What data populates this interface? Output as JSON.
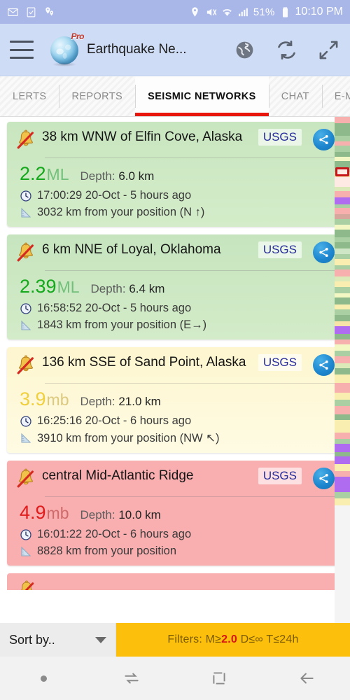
{
  "status_bar": {
    "left_icons": [
      "gmail-icon",
      "tasks-icon",
      "location-pins-icon"
    ],
    "right_icons": [
      "location-icon",
      "mute-icon",
      "wifi-icon",
      "signal-icon",
      "battery-icon"
    ],
    "battery_percent": "51%",
    "time": "10:10 PM"
  },
  "app_bar": {
    "menu_icon": "hamburger-menu-icon",
    "logo_badge": "Pro",
    "title": "Earthquake Ne...",
    "actions": [
      {
        "name": "map-globe-button",
        "icon": "globe-icon"
      },
      {
        "name": "refresh-button",
        "icon": "refresh-icon"
      },
      {
        "name": "fullscreen-button",
        "icon": "expand-icon"
      }
    ]
  },
  "tabs": [
    {
      "label": "LERTS",
      "active": false
    },
    {
      "label": "REPORTS",
      "active": false
    },
    {
      "label": "SEISMIC NETWORKS",
      "active": true
    },
    {
      "label": "CHAT",
      "active": false
    },
    {
      "label": "E-MAILS",
      "active": false
    }
  ],
  "quakes": [
    {
      "place": "38 km WNW of Elfin Cove, Alaska",
      "source": "USGS",
      "magnitude": "2.2",
      "mag_unit": "ML",
      "depth_label": "Depth:",
      "depth_value": "6.0 km",
      "time": "17:00:29 20-Oct - 5 hours ago",
      "distance": "3032 km from your position (N ↑)",
      "theme": "green",
      "alert_icon": "bell-muted-icon"
    },
    {
      "place": "6 km NNE of Loyal, Oklahoma",
      "source": "USGS",
      "magnitude": "2.39",
      "mag_unit": "ML",
      "depth_label": "Depth:",
      "depth_value": "6.4 km",
      "time": "16:58:52 20-Oct - 5 hours ago",
      "distance": "1843 km from your position (E→)",
      "theme": "green2",
      "alert_icon": "bell-muted-icon"
    },
    {
      "place": "136 km SSE of Sand Point, Alaska",
      "source": "USGS",
      "magnitude": "3.9",
      "mag_unit": "mb",
      "depth_label": "Depth:",
      "depth_value": "21.0 km",
      "time": "16:25:16 20-Oct - 6 hours ago",
      "distance": "3910 km from your position (NW ↖)",
      "theme": "yellow",
      "alert_icon": "bell-muted-icon"
    },
    {
      "place": "central Mid-Atlantic Ridge",
      "source": "USGS",
      "magnitude": "4.9",
      "mag_unit": "mb",
      "depth_label": "Depth:",
      "depth_value": "10.0 km",
      "time": "16:01:22 20-Oct - 6 hours ago",
      "distance": "8828 km from your position",
      "theme": "red",
      "alert_icon": "bell-muted-icon"
    }
  ],
  "color_strip": {
    "marker_top_px": 72,
    "bands": [
      {
        "color": "#f7b0ad",
        "h": 9
      },
      {
        "color": "#8db98b",
        "h": 7
      },
      {
        "color": "#8db98b",
        "h": 11
      },
      {
        "color": "#a9cfa2",
        "h": 8
      },
      {
        "color": "#f7b0ad",
        "h": 6
      },
      {
        "color": "#a9cfa2",
        "h": 9
      },
      {
        "color": "#8db98b",
        "h": 7
      },
      {
        "color": "#f3f7c4",
        "h": 6
      },
      {
        "color": "#8db98b",
        "h": 10
      },
      {
        "color": "#a9cfa2",
        "h": 6
      },
      {
        "color": "#f7e2a8",
        "h": 7
      },
      {
        "color": "#ffe9e3",
        "h": 14
      },
      {
        "color": "#dce9b9",
        "h": 6
      },
      {
        "color": "#f7b0ad",
        "h": 9
      },
      {
        "color": "#b06cf0",
        "h": 10
      },
      {
        "color": "#a9cfa2",
        "h": 5
      },
      {
        "color": "#f7b0ad",
        "h": 9
      },
      {
        "color": "#d6a79c",
        "h": 7
      },
      {
        "color": "#a9cfa2",
        "h": 8
      },
      {
        "color": "#f3f7c4",
        "h": 7
      },
      {
        "color": "#8db98b",
        "h": 11
      },
      {
        "color": "#a9cfa2",
        "h": 7
      },
      {
        "color": "#8db98b",
        "h": 9
      },
      {
        "color": "#cfe6c6",
        "h": 8
      },
      {
        "color": "#a9cfa2",
        "h": 7
      },
      {
        "color": "#f9edb0",
        "h": 9
      },
      {
        "color": "#a9cfa2",
        "h": 6
      },
      {
        "color": "#f7b0ad",
        "h": 10
      },
      {
        "color": "#dce9b9",
        "h": 7
      },
      {
        "color": "#f9edb0",
        "h": 8
      },
      {
        "color": "#a9cfa2",
        "h": 9
      },
      {
        "color": "#f3f7c4",
        "h": 6
      },
      {
        "color": "#8db98b",
        "h": 10
      },
      {
        "color": "#f9edb0",
        "h": 7
      },
      {
        "color": "#a9cfa2",
        "h": 8
      },
      {
        "color": "#8db98b",
        "h": 9
      },
      {
        "color": "#f7e2a8",
        "h": 7
      },
      {
        "color": "#b06cf0",
        "h": 11
      },
      {
        "color": "#8db98b",
        "h": 8
      },
      {
        "color": "#f7b0ad",
        "h": 7
      },
      {
        "color": "#f3f7c4",
        "h": 9
      },
      {
        "color": "#a9cfa2",
        "h": 8
      },
      {
        "color": "#f7b0ad",
        "h": 10
      },
      {
        "color": "#dce9b9",
        "h": 7
      },
      {
        "color": "#8db98b",
        "h": 9
      },
      {
        "color": "#f9edb0",
        "h": 12
      },
      {
        "color": "#f7b0ad",
        "h": 14
      },
      {
        "color": "#f9edb0",
        "h": 10
      },
      {
        "color": "#a9cfa2",
        "h": 9
      },
      {
        "color": "#f7b0ad",
        "h": 12
      },
      {
        "color": "#8db98b",
        "h": 8
      },
      {
        "color": "#f9edb0",
        "h": 18
      },
      {
        "color": "#f7b0ad",
        "h": 9
      },
      {
        "color": "#a9cfa2",
        "h": 7
      },
      {
        "color": "#b06cf0",
        "h": 12
      },
      {
        "color": "#8db98b",
        "h": 6
      },
      {
        "color": "#b06cf0",
        "h": 11
      },
      {
        "color": "#f9edb0",
        "h": 10
      },
      {
        "color": "#f7b0ad",
        "h": 8
      },
      {
        "color": "#b06cf0",
        "h": 22
      },
      {
        "color": "#a9cfa2",
        "h": 9
      },
      {
        "color": "#f9edb0",
        "h": 10
      }
    ]
  },
  "bottom_bar": {
    "sort_label": "Sort by..",
    "sort_caret": "chevron-down-icon",
    "filters_prefix": "Filters: M≥",
    "filters_mag": "2.0",
    "filters_suffix": " D≤∞ T≤24h"
  },
  "nav_bar": [
    {
      "name": "nav-dot",
      "icon": "dot-icon"
    },
    {
      "name": "nav-recents",
      "icon": "recents-icon"
    },
    {
      "name": "nav-home",
      "icon": "home-square-icon"
    },
    {
      "name": "nav-back",
      "icon": "back-arrow-icon"
    }
  ]
}
